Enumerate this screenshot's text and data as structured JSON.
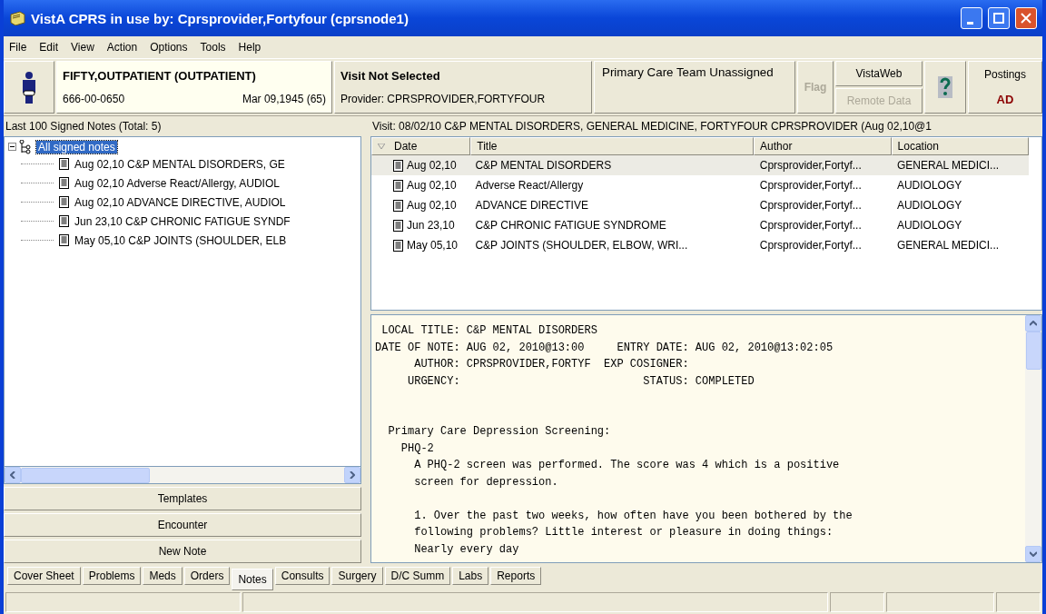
{
  "window": {
    "title": "VistA CPRS in use by: Cprsprovider,Fortyfour  (cprsnode1)"
  },
  "menu": [
    "File",
    "Edit",
    "View",
    "Action",
    "Options",
    "Tools",
    "Help"
  ],
  "patient": {
    "name": "FIFTY,OUTPATIENT (OUTPATIENT)",
    "ssn": "666-00-0650",
    "dob": "Mar 09,1945 (65)"
  },
  "visit": {
    "title": "Visit Not Selected",
    "provider": "Provider:  CPRSPROVIDER,FORTYFOUR"
  },
  "care_team": "Primary Care Team Unassigned",
  "flag": {
    "label": "Flag",
    "disabled": true
  },
  "vistaweb": {
    "label": "VistaWeb",
    "remote": "Remote Data",
    "remote_disabled": true
  },
  "postings": {
    "label": "Postings",
    "code": "AD"
  },
  "notes_label": "Last 100 Signed Notes (Total: 5)",
  "tree": {
    "label": "All signed notes",
    "selected": true,
    "expanded": true,
    "children": [
      {
        "label": "Aug 02,10  C&P MENTAL DISORDERS, GE",
        "selected": false
      },
      {
        "label": "Aug 02,10  Adverse React/Allergy, AUDIOL",
        "selected": false
      },
      {
        "label": "Aug 02,10  ADVANCE DIRECTIVE, AUDIOL",
        "selected": false
      },
      {
        "label": "Jun 23,10  C&P CHRONIC FATIGUE SYNDF",
        "selected": false
      },
      {
        "label": "May 05,10  C&P JOINTS (SHOULDER, ELB",
        "selected": false
      }
    ]
  },
  "buttons": [
    "Templates",
    "Encounter",
    "New Note"
  ],
  "visit_line": "Visit: 08/02/10   C&P MENTAL DISORDERS, GENERAL MEDICINE, FORTYFOUR CPRSPROVIDER  (Aug 02,10@1",
  "table": {
    "columns": [
      "Date",
      "Title",
      "Author",
      "Location"
    ],
    "rows": [
      {
        "date": "Aug 02,10",
        "title": "C&P MENTAL DISORDERS",
        "author": "Cprsprovider,Fortyf...",
        "location": "GENERAL MEDICI...",
        "selected": true
      },
      {
        "date": "Aug 02,10",
        "title": "Adverse React/Allergy",
        "author": "Cprsprovider,Fortyf...",
        "location": "AUDIOLOGY",
        "selected": false
      },
      {
        "date": "Aug 02,10",
        "title": "ADVANCE DIRECTIVE",
        "author": "Cprsprovider,Fortyf...",
        "location": "AUDIOLOGY",
        "selected": false
      },
      {
        "date": "Jun 23,10",
        "title": "C&P CHRONIC FATIGUE SYNDROME",
        "author": "Cprsprovider,Fortyf...",
        "location": "AUDIOLOGY",
        "selected": false
      },
      {
        "date": "May 05,10",
        "title": "C&P JOINTS (SHOULDER, ELBOW, WRI...",
        "author": "Cprsprovider,Fortyf...",
        "location": "GENERAL MEDICI...",
        "selected": false
      }
    ]
  },
  "note": {
    "sections": [
      {
        "kind": "header",
        "lines": [
          " LOCAL TITLE: C&P MENTAL DISORDERS",
          "DATE OF NOTE: AUG 02, 2010@13:00     ENTRY DATE: AUG 02, 2010@13:02:05",
          "      AUTHOR: CPRSPROVIDER,FORTYF  EXP COSIGNER:",
          "     URGENCY:                            STATUS: COMPLETED"
        ]
      },
      {
        "kind": "body",
        "lines": [
          "  Primary Care Depression Screening:",
          "    PHQ-2",
          "      A PHQ-2 screen was performed. The score was 4 which is a positive",
          "      screen for depression."
        ]
      },
      {
        "kind": "body",
        "lines": [
          "      1. Over the past two weeks, how often have you been bothered by the",
          "      following problems? Little interest or pleasure in doing things:",
          "      Nearly every day"
        ]
      }
    ]
  },
  "tabs": [
    {
      "label": "Cover Sheet",
      "selected": false
    },
    {
      "label": "Problems",
      "selected": false
    },
    {
      "label": "Meds",
      "selected": false
    },
    {
      "label": "Orders",
      "selected": false
    },
    {
      "label": "Notes",
      "selected": true
    },
    {
      "label": "Consults",
      "selected": false
    },
    {
      "label": "Surgery",
      "selected": false
    },
    {
      "label": "D/C Summ",
      "selected": false
    },
    {
      "label": "Labs",
      "selected": false
    },
    {
      "label": "Reports",
      "selected": false
    }
  ]
}
